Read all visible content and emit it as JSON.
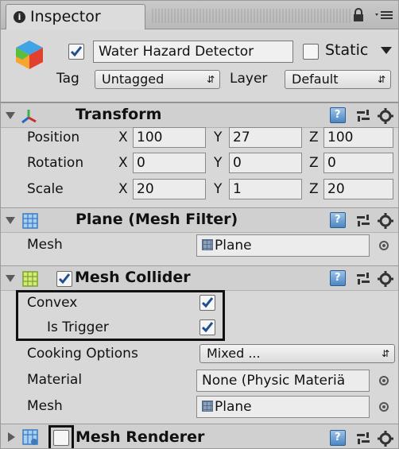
{
  "window": {
    "tab_label": "Inspector",
    "tab_icon": "info-icon"
  },
  "game_object": {
    "active": true,
    "name": "Water Hazard Detector",
    "static_label": "Static",
    "static": false,
    "tag_label": "Tag",
    "tag_value": "Untagged",
    "layer_label": "Layer",
    "layer_value": "Default"
  },
  "transform": {
    "title": "Transform",
    "rows": [
      {
        "label": "Position",
        "x": "100",
        "y": "27",
        "z": "100"
      },
      {
        "label": "Rotation",
        "x": "0",
        "y": "0",
        "z": "0"
      },
      {
        "label": "Scale",
        "x": "20",
        "y": "1",
        "z": "20"
      }
    ],
    "axes": {
      "x": "X",
      "y": "Y",
      "z": "Z"
    }
  },
  "mesh_filter": {
    "title": "Plane (Mesh Filter)",
    "mesh_label": "Mesh",
    "mesh_value": "Plane"
  },
  "mesh_collider": {
    "title": "Mesh Collider",
    "enabled": true,
    "convex_label": "Convex",
    "convex": true,
    "trigger_label": "Is Trigger",
    "trigger": true,
    "cooking_label": "Cooking Options",
    "cooking_value": "Mixed ...",
    "material_label": "Material",
    "material_value": "None (Physic Materiä",
    "mesh_label": "Mesh",
    "mesh_value": "Plane"
  },
  "mesh_renderer": {
    "title": "Mesh Renderer",
    "enabled": false
  },
  "colors": {
    "panel_bg": "#d8d8d8",
    "header_bg": "#d0d0d0",
    "check_blue": "#1f4f8f",
    "help_blue": "#4c86c2"
  }
}
